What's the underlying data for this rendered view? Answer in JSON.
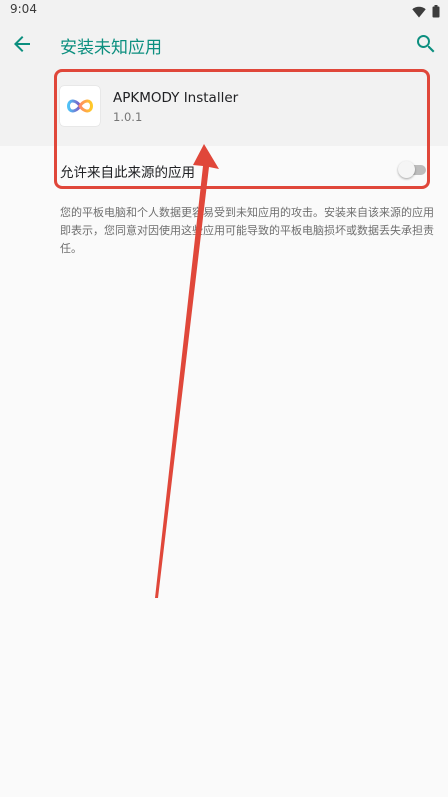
{
  "status_bar": {
    "time": "9:04",
    "icons": [
      "wifi-icon",
      "battery-icon"
    ]
  },
  "app_bar": {
    "title": "安装未知应用",
    "back_icon": "arrow-back-icon",
    "search_icon": "search-icon"
  },
  "app_info": {
    "name": "APKMODY Installer",
    "version": "1.0.1",
    "icon": "infinity-logo-icon"
  },
  "permission": {
    "label": "允许来自此来源的应用",
    "enabled": false
  },
  "warning": {
    "text": "您的平板电脑和个人数据更容易受到未知应用的攻击。安装来自该来源的应用即表示，您同意对因使用这些应用可能导致的平板电脑损坏或数据丢失承担责任。"
  },
  "annotation": {
    "highlight_color": "#e0473a",
    "arrow_color": "#e0473a"
  },
  "colors": {
    "accent": "#0c8f7f",
    "background": "#fafafa",
    "header_background": "#f2f2f2"
  }
}
